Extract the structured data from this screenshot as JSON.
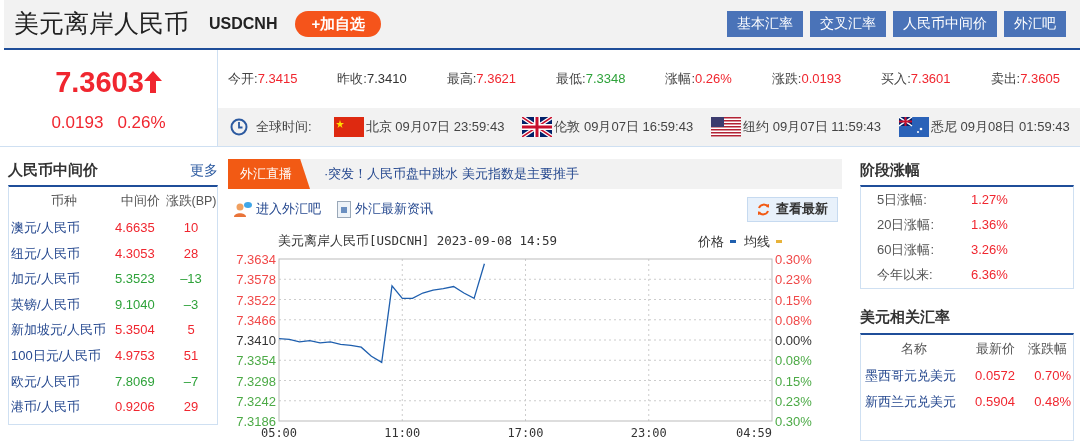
{
  "header": {
    "title": "美元离岸人民币",
    "code": "USDCNH",
    "add_button": "+加自选",
    "nav_buttons": [
      "基本汇率",
      "交叉汇率",
      "人民币中间价",
      "外汇吧"
    ]
  },
  "quote": {
    "price": "7.3603",
    "color": "#f0262f",
    "change": "0.0193",
    "change_pct": "0.26%"
  },
  "stats": [
    {
      "label": "今开:",
      "value": "7.3415",
      "color": "#f0262f"
    },
    {
      "label": "昨收:",
      "value": "7.3410",
      "color": "#333333"
    },
    {
      "label": "最高:",
      "value": "7.3621",
      "color": "#f0262f"
    },
    {
      "label": "最低:",
      "value": "7.3348",
      "color": "#2ea23a"
    },
    {
      "label": "涨幅:",
      "value": "0.26%",
      "color": "#f0262f"
    },
    {
      "label": "涨跌:",
      "value": "0.0193",
      "color": "#f0262f"
    },
    {
      "label": "买入:",
      "value": "7.3601",
      "color": "#f0262f"
    },
    {
      "label": "卖出:",
      "value": "7.3605",
      "color": "#f0262f"
    }
  ],
  "world_time": {
    "label": "全球时间:",
    "cities": [
      {
        "city": "北京",
        "time": "09月07日 23:59:43"
      },
      {
        "city": "伦敦",
        "time": "09月07日 16:59:43"
      },
      {
        "city": "纽约",
        "time": "09月07日 11:59:43"
      },
      {
        "city": "悉尼",
        "time": "09月08日 01:59:43"
      }
    ]
  },
  "mid_rate_panel": {
    "title": "人民币中间价",
    "more": "更多",
    "columns": [
      "币种",
      "中间价",
      "涨跌(BP)"
    ],
    "rows": [
      {
        "pair": "澳元/人民币",
        "price": "4.6635",
        "change": "10",
        "color": "#f0262f"
      },
      {
        "pair": "纽元/人民币",
        "price": "4.3053",
        "change": "28",
        "color": "#f0262f"
      },
      {
        "pair": "加元/人民币",
        "price": "5.3523",
        "change": "–13",
        "color": "#2ea23a"
      },
      {
        "pair": "英镑/人民币",
        "price": "9.1040",
        "change": "–3",
        "color": "#2ea23a"
      },
      {
        "pair": "新加坡元/人民币",
        "price": "5.3504",
        "change": "5",
        "color": "#f0262f"
      },
      {
        "pair": "100日元/人民币",
        "price": "4.9753",
        "change": "51",
        "color": "#f0262f"
      },
      {
        "pair": "欧元/人民币",
        "price": "7.8069",
        "change": "–7",
        "color": "#2ea23a"
      },
      {
        "pair": "港币/人民币",
        "price": "0.9206",
        "change": "29",
        "color": "#f0262f"
      }
    ]
  },
  "news": {
    "tab": "外汇直播",
    "headline": "·突发！人民币盘中跳水 美元指数是主要推手"
  },
  "links": [
    "进入外汇吧",
    "外汇最新资讯"
  ],
  "refresh_button": "查看最新",
  "chart": {
    "legend": [
      {
        "label": "均线",
        "color": "#e8b33a"
      }
    ],
    "right_axis": [
      {
        "label": "0.30%",
        "color": "#f04848"
      },
      {
        "label": "0.23%",
        "color": "#f04848"
      },
      {
        "label": "0.15%",
        "color": "#f04848"
      },
      {
        "label": "0.08%",
        "color": "#f04848"
      },
      {
        "label": "0.00%",
        "color": "#333333"
      },
      {
        "label": "0.08%",
        "color": "#4caa46"
      },
      {
        "label": "0.15%",
        "color": "#4caa46"
      },
      {
        "label": "0.23%",
        "color": "#4caa46"
      },
      {
        "label": "0.30%",
        "color": "#4caa46"
      }
    ],
    "chart_data": {
      "type": "line",
      "title": "美元离岸人民币[USDCNH] 2023-09-08 14:59",
      "ylim": [
        7.3186,
        7.3634
      ],
      "grid": true,
      "categories": [
        "05:00",
        null,
        null,
        null,
        null,
        null,
        null,
        null,
        null,
        null,
        null,
        null,
        "11:00",
        null,
        null,
        null,
        null,
        null,
        null,
        null,
        null,
        null,
        null,
        null,
        "17:00",
        null,
        null,
        null,
        null,
        null,
        null,
        null,
        null,
        null,
        null,
        null,
        "23:00",
        null,
        null,
        null,
        null,
        null,
        null,
        null,
        null,
        null,
        null,
        null,
        "04:59"
      ],
      "yticks": [
        {
          "value": 7.3634,
          "label": "7.3634"
        },
        {
          "value": 7.3578,
          "label": "7.3578"
        },
        {
          "value": 7.3522,
          "label": "7.3522"
        },
        {
          "value": 7.3466,
          "label": "7.3466"
        },
        {
          "value": 7.341,
          "label": "7.3410"
        },
        {
          "value": 7.3354,
          "label": "7.3354"
        },
        {
          "value": 7.3298,
          "label": "7.3298"
        },
        {
          "value": 7.3242,
          "label": "7.3242"
        },
        {
          "value": 7.3186,
          "label": "7.3186"
        }
      ],
      "series": [
        {
          "name": "价格",
          "color": "#1f5fae",
          "values": [
            7.3414,
            7.3412,
            7.3405,
            7.3408,
            7.3402,
            7.3405,
            7.3398,
            7.3395,
            7.339,
            7.3365,
            7.3348,
            7.356,
            7.3525,
            7.3525,
            7.354,
            7.3548,
            7.3552,
            7.3558,
            7.354,
            7.3525,
            7.3621,
            null,
            null,
            null,
            null,
            null,
            null,
            null,
            null,
            null,
            null,
            null,
            null,
            null,
            null,
            null,
            null,
            null,
            null,
            null,
            null,
            null,
            null,
            null,
            null,
            null,
            null,
            null,
            null
          ]
        }
      ]
    }
  },
  "period_change": {
    "title": "阶段涨幅",
    "rows": [
      {
        "label": "5日涨幅:",
        "value": "1.27%",
        "color": "#f0262f"
      },
      {
        "label": "20日涨幅:",
        "value": "1.36%",
        "color": "#f0262f"
      },
      {
        "label": "60日涨幅:",
        "value": "3.26%",
        "color": "#f0262f"
      },
      {
        "label": "今年以来:",
        "value": "6.36%",
        "color": "#f0262f"
      }
    ]
  },
  "usd_rates": {
    "title": "美元相关汇率",
    "columns": [
      "名称",
      "最新价",
      "涨跌幅"
    ],
    "rows": [
      {
        "name": "墨西哥元兑美元",
        "price": "0.0572",
        "change": "0.70%",
        "color": "#f0262f"
      },
      {
        "name": "新西兰元兑美元",
        "price": "0.5904",
        "change": "0.48%",
        "color": "#f0262f"
      }
    ]
  }
}
